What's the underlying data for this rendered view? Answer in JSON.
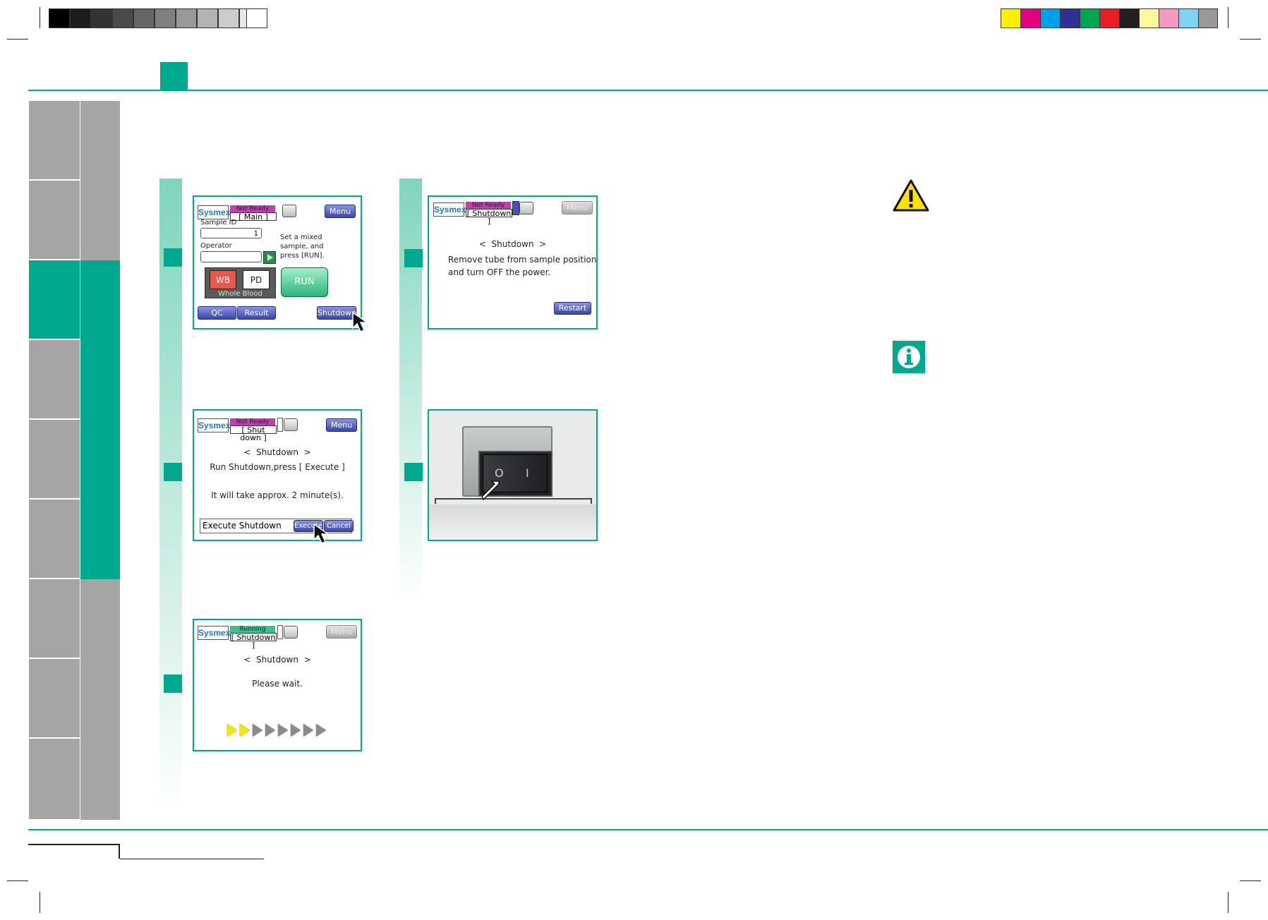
{
  "colors": {
    "accent": "#00a88e",
    "tab_gray": "#a5a5a5",
    "status_not_ready": "#c040b0",
    "status_running": "#3fbf8f",
    "button_blue": "#3b46a8",
    "wb_red": "#e8584a",
    "run_green": "#2fb37a"
  },
  "icons": {
    "warning": "warning-triangle-icon",
    "info": "info-icon",
    "cursor": "mouse-pointer-icon",
    "floppy": "floppy-disk-icon",
    "play": "play-icon"
  },
  "screen1": {
    "logo": "Sysmex",
    "status": "Not Ready",
    "mode": "[ Main ]",
    "menu": "Menu",
    "sample_id_label": "Sample ID",
    "sample_id_value": "1",
    "operator_label": "Operator",
    "instruction": "Set a mixed sample, and press [RUN].",
    "wb": "WB",
    "pd": "PD",
    "whole_blood": "Whole Blood",
    "run": "RUN",
    "qc": "QC",
    "result": "Result",
    "shutdown": "Shutdown"
  },
  "screen2": {
    "logo": "Sysmex",
    "status": "Not Ready",
    "mode": "[ Shut down ]",
    "menu": "Menu",
    "title": "<  Shutdown  >",
    "line1": "Run Shutdown,press [ Execute ]",
    "line2": "It will take approx.  2 minute(s).",
    "field": "Execute Shutdown",
    "execute": "Execute",
    "cancel": "Cancel"
  },
  "screen3": {
    "logo": "Sysmex",
    "status": "Running",
    "mode": "[ Shutdown ]",
    "menu": "Menu",
    "title": "<  Shutdown  >",
    "line1": "Please wait.",
    "progress_done": 2,
    "progress_total": 8
  },
  "screen4": {
    "logo": "Sysmex",
    "status": "Not Ready",
    "mode": "[ Shutdown ]",
    "menu": "Menu",
    "title": "<  Shutdown  >",
    "line1": "Remove tube from sample position",
    "line2": "and turn OFF the power.",
    "restart": "Restart"
  },
  "power_switch": {
    "off_symbol": "O",
    "on_symbol": "I"
  }
}
